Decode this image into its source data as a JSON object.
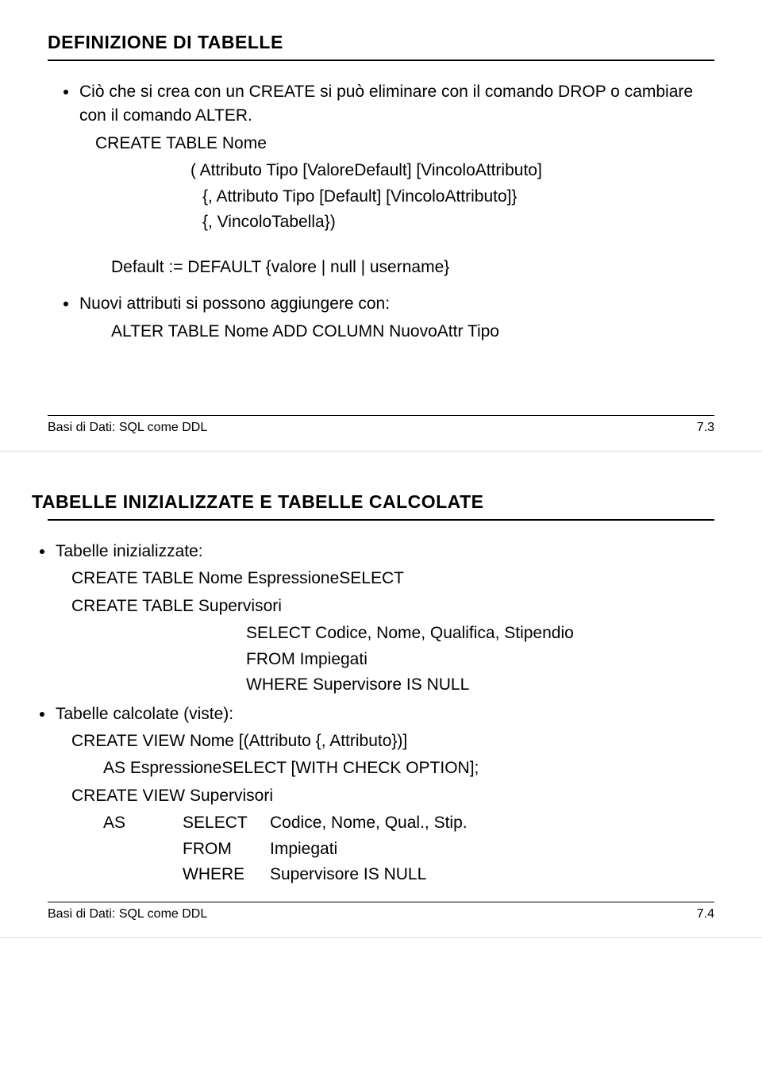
{
  "slide1": {
    "title": "DEFINIZIONE DI TABELLE",
    "bullet1": "Ciò che si crea con un CREATE si può eliminare con il comando DROP o cambiare con il comando ALTER.",
    "code1_l1": "CREATE TABLE  Nome",
    "code1_l2": "( Attributo  Tipo [ValoreDefault] [VincoloAttributo]",
    "code1_l3": "{, Attributo  Tipo [Default] [VincoloAttributo]}",
    "code1_l4": "{, VincoloTabella})",
    "code2": "Default := DEFAULT {valore | null | username}",
    "bullet2": "Nuovi attributi si possono aggiungere con:",
    "code3": "ALTER TABLE  Nome  ADD COLUMN NuovoAttr  Tipo",
    "footer_left": "Basi di Dati: SQL come DDL",
    "footer_right": "7.3"
  },
  "slide2": {
    "title": "TABELLE INIZIALIZZATE E TABELLE CALCOLATE",
    "bullet1": "Tabelle inizializzate:",
    "code1_l1": "CREATE TABLE  Nome EspressioneSELECT",
    "code1_l2": "CREATE TABLE Supervisori",
    "code1_l3": "SELECT  Codice, Nome, Qualifica, Stipendio",
    "code1_l4": "FROM   Impiegati",
    "code1_l5": "WHERE Supervisore IS NULL",
    "bullet2": "Tabelle calcolate (viste):",
    "code2_l1": "CREATE VIEW Nome [(Attributo {, Attributo})]",
    "code2_l2": "AS EspressioneSELECT [WITH CHECK OPTION];",
    "code2_l3": "CREATE VIEW Supervisori",
    "row1_c1": "AS",
    "row1_c2": "SELECT",
    "row1_c3": "Codice, Nome, Qual., Stip.",
    "row2_c2": "FROM",
    "row2_c3": "Impiegati",
    "row3_c2": "WHERE",
    "row3_c3": "Supervisore IS NULL",
    "footer_left": "Basi di Dati: SQL come DDL",
    "footer_right": "7.4"
  }
}
